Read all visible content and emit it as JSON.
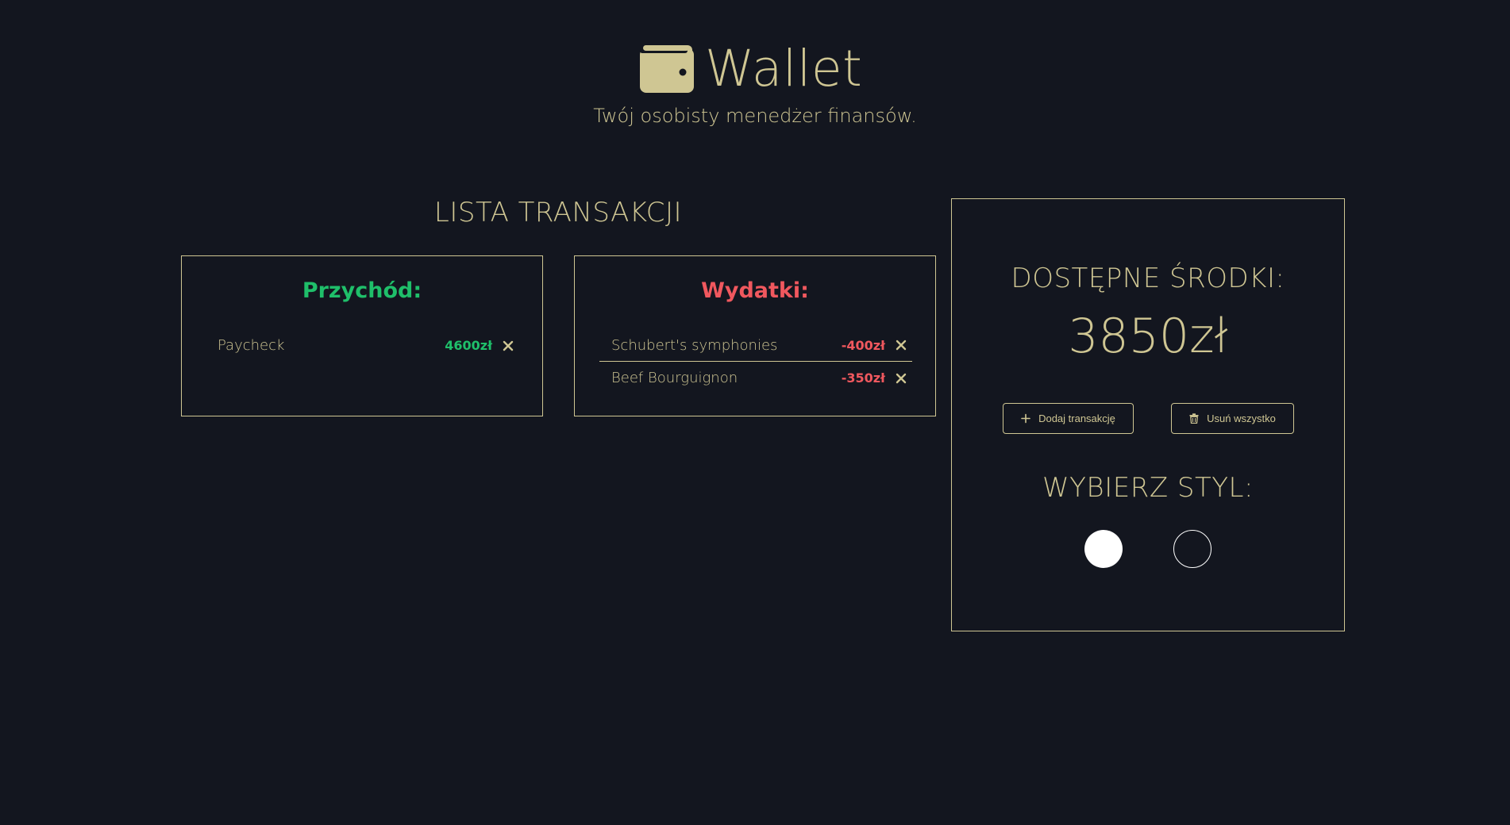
{
  "header": {
    "icon": "wallet-icon",
    "title": "Wallet",
    "subtitle": "Twój osobisty menedżer finansów."
  },
  "transactions": {
    "title": "LISTA TRANSAKCJI",
    "income": {
      "heading": "Przychód:",
      "items": [
        {
          "name": "Paycheck",
          "amount": "4600zł"
        }
      ]
    },
    "expenses": {
      "heading": "Wydatki:",
      "items": [
        {
          "name": "Schubert's symphonies",
          "amount": "-400zł"
        },
        {
          "name": "Beef Bourguignon",
          "amount": "-350zł"
        }
      ]
    }
  },
  "balance": {
    "label": "DOSTĘPNE ŚRODKI:",
    "value": "3850zł",
    "add_button": "Dodaj transakcję",
    "clear_button": "Usuń wszystko"
  },
  "style": {
    "label": "WYBIERZ STYL:",
    "options": [
      {
        "name": "light",
        "color": "#ffffff"
      },
      {
        "name": "dark",
        "color": "#13161f"
      }
    ]
  },
  "colors": {
    "background": "#13161f",
    "accent": "#cfc693",
    "income": "#1fbf6a",
    "expense": "#f0585e"
  }
}
